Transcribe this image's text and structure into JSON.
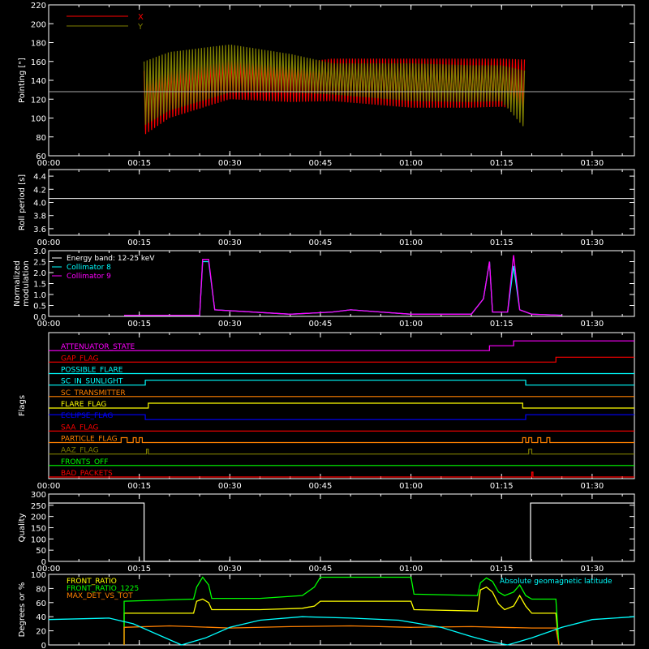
{
  "time_ticks": [
    "00:00",
    "00:15",
    "00:30",
    "00:45",
    "01:00",
    "01:15",
    "01:30"
  ],
  "chart_data": [
    {
      "type": "line",
      "ylabel": "Pointing [\"]",
      "ylim": [
        60,
        220
      ],
      "xlim_min": [
        0,
        97
      ],
      "yticks": [
        60,
        80,
        100,
        120,
        140,
        160,
        180,
        200,
        220
      ],
      "legend": [
        {
          "name": "X",
          "color": "#ff0000"
        },
        {
          "name": "Y",
          "color": "#808000"
        }
      ],
      "reference_line": 128,
      "series": [
        {
          "name": "X",
          "color": "#ff0000",
          "upper": [
            [
              15.8,
              150
            ],
            [
              20,
              155
            ],
            [
              30,
              162
            ],
            [
              40,
              158
            ],
            [
              47,
              163
            ],
            [
              60,
              163
            ],
            [
              70,
              163
            ],
            [
              75,
              163
            ],
            [
              79,
              162
            ]
          ],
          "lower": [
            [
              15.8,
              82
            ],
            [
              20,
              100
            ],
            [
              30,
              120
            ],
            [
              40,
              117
            ],
            [
              47,
              118
            ],
            [
              60,
              111
            ],
            [
              70,
              111
            ],
            [
              75,
              112
            ],
            [
              79,
              108
            ]
          ]
        },
        {
          "name": "Y",
          "color": "#808000",
          "upper": [
            [
              15.8,
              160
            ],
            [
              20,
              170
            ],
            [
              30,
              178
            ],
            [
              40,
              168
            ],
            [
              47,
              158
            ],
            [
              60,
              158
            ],
            [
              70,
              156
            ],
            [
              75,
              156
            ],
            [
              79,
              150
            ]
          ],
          "lower": [
            [
              15.8,
              92
            ],
            [
              20,
              108
            ],
            [
              30,
              127
            ],
            [
              40,
              127
            ],
            [
              47,
              125
            ],
            [
              60,
              118
            ],
            [
              70,
              117
            ],
            [
              75,
              118
            ],
            [
              79,
              88
            ]
          ]
        }
      ]
    },
    {
      "type": "line",
      "ylabel": "Roll period [s]",
      "ylim": [
        3.5,
        4.5
      ],
      "yticks": [
        3.6,
        3.8,
        4.0,
        4.2,
        4.4
      ],
      "series": [
        {
          "name": "",
          "color": "#ffffff",
          "constant": 4.06,
          "span": [
            0,
            97
          ]
        }
      ]
    },
    {
      "type": "line",
      "ylabel_lines": [
        "Normalized",
        "modulation"
      ],
      "ylim": [
        0,
        3.0
      ],
      "yticks": [
        0.0,
        0.5,
        1.0,
        1.5,
        2.0,
        2.5,
        3.0
      ],
      "legend": [
        {
          "name": "Energy band: 12-25 keV",
          "color": "#ffffff"
        },
        {
          "name": "Collimator 8",
          "color": "#00ffff"
        },
        {
          "name": "Collimator 9",
          "color": "#ff00ff"
        }
      ],
      "series": [
        {
          "name": "Collimator 8",
          "color": "#00ffff",
          "points": [
            [
              12.5,
              0.05
            ],
            [
              25,
              0.05
            ],
            [
              25.5,
              2.5
            ],
            [
              26.5,
              2.5
            ],
            [
              27.5,
              0.3
            ],
            [
              40,
              0.1
            ],
            [
              47,
              0.2
            ],
            [
              50,
              0.3
            ],
            [
              55,
              0.2
            ],
            [
              60,
              0.1
            ],
            [
              70,
              0.1
            ],
            [
              72,
              0.8
            ],
            [
              73,
              2.5
            ],
            [
              73.5,
              0.2
            ],
            [
              76,
              0.2
            ],
            [
              77,
              2.3
            ],
            [
              78,
              0.3
            ],
            [
              80,
              0.1
            ],
            [
              85,
              0.05
            ]
          ]
        },
        {
          "name": "Collimator 9",
          "color": "#ff00ff",
          "points": [
            [
              12.5,
              0.05
            ],
            [
              25,
              0.05
            ],
            [
              25.5,
              2.6
            ],
            [
              26.5,
              2.6
            ],
            [
              27.5,
              0.3
            ],
            [
              40,
              0.1
            ],
            [
              47,
              0.2
            ],
            [
              50,
              0.3
            ],
            [
              55,
              0.2
            ],
            [
              60,
              0.1
            ],
            [
              70,
              0.1
            ],
            [
              72,
              0.8
            ],
            [
              73,
              2.5
            ],
            [
              73.5,
              0.2
            ],
            [
              76,
              0.2
            ],
            [
              77,
              2.8
            ],
            [
              78,
              0.3
            ],
            [
              80,
              0.1
            ],
            [
              85,
              0.05
            ]
          ]
        }
      ]
    },
    {
      "type": "line",
      "ylabel": "Flags",
      "flags": [
        {
          "name": "ATTENUATOR_STATE",
          "color": "#ff00ff",
          "steps": [
            [
              0,
              0
            ],
            [
              73,
              1
            ],
            [
              77,
              2
            ],
            [
              97,
              2
            ]
          ]
        },
        {
          "name": "GAP_FLAG",
          "color": "#ff0000",
          "steps": [
            [
              0,
              0
            ],
            [
              84,
              1
            ],
            [
              97,
              1
            ]
          ]
        },
        {
          "name": "POSSIBLE_FLARE",
          "color": "#00ffff",
          "steps": [
            [
              0,
              0
            ],
            [
              97,
              0
            ]
          ]
        },
        {
          "name": "SC_IN_SUNLIGHT",
          "color": "#00ffff",
          "steps": [
            [
              0,
              0
            ],
            [
              16,
              1
            ],
            [
              79,
              0
            ],
            [
              97,
              0
            ]
          ]
        },
        {
          "name": "SC_TRANSMITTER",
          "color": "#ff8000",
          "steps": [
            [
              0,
              0
            ],
            [
              97,
              0
            ]
          ]
        },
        {
          "name": "FLARE_FLAG",
          "color": "#ffff00",
          "steps": [
            [
              0,
              0
            ],
            [
              16.5,
              1
            ],
            [
              78.5,
              0
            ],
            [
              97,
              0
            ]
          ]
        },
        {
          "name": "ECLIPSE_FLAG",
          "color": "#0000ff",
          "steps": [
            [
              0,
              1
            ],
            [
              16,
              0
            ],
            [
              79,
              1
            ],
            [
              97,
              1
            ]
          ]
        },
        {
          "name": "SAA_FLAG",
          "color": "#ff0000",
          "steps": [
            [
              0,
              0
            ],
            [
              97,
              0
            ]
          ]
        },
        {
          "name": "PARTICLE_FLAG",
          "color": "#ff8000",
          "steps": [
            [
              0,
              0
            ],
            [
              12,
              1
            ],
            [
              13,
              0
            ],
            [
              14,
              1
            ],
            [
              14.5,
              0
            ],
            [
              15,
              1
            ],
            [
              15.5,
              0
            ],
            [
              78.5,
              1
            ],
            [
              79,
              0
            ],
            [
              79.5,
              1
            ],
            [
              80,
              0
            ],
            [
              81,
              1
            ],
            [
              81.5,
              0
            ],
            [
              82.5,
              1
            ],
            [
              83,
              0
            ],
            [
              97,
              0
            ]
          ]
        },
        {
          "name": "AAZ_FLAG",
          "color": "#808000",
          "steps": [
            [
              0,
              0
            ],
            [
              16.2,
              1
            ],
            [
              16.5,
              0
            ],
            [
              79.5,
              1
            ],
            [
              80,
              0
            ],
            [
              97,
              0
            ]
          ]
        },
        {
          "name": "FRONTS_OFF",
          "color": "#00ff00",
          "steps": [
            [
              0,
              0
            ],
            [
              97,
              0
            ]
          ]
        },
        {
          "name": "BAD_PACKETS",
          "color": "#ff0000",
          "steps": [
            [
              0,
              0
            ],
            [
              80,
              1
            ],
            [
              80.2,
              0
            ],
            [
              97,
              0
            ]
          ]
        }
      ]
    },
    {
      "type": "line",
      "ylabel": "Quality",
      "ylim": [
        0,
        300
      ],
      "yticks": [
        0,
        50,
        100,
        150,
        200,
        250,
        300
      ],
      "series": [
        {
          "name": "",
          "color": "#ffffff",
          "steps": [
            [
              0,
              260
            ],
            [
              15.8,
              260
            ],
            [
              15.8,
              0
            ],
            [
              79.8,
              0
            ],
            [
              79.8,
              260
            ],
            [
              97,
              260
            ]
          ]
        }
      ]
    },
    {
      "type": "line",
      "ylabel": "Degrees or %",
      "ylim": [
        0,
        100
      ],
      "yticks": [
        0,
        20,
        40,
        60,
        80,
        100
      ],
      "legend": [
        {
          "name": "FRONT_RATIO",
          "color": "#ffff00"
        },
        {
          "name": "FRONT_RATIO_1225",
          "color": "#00ff00"
        },
        {
          "name": "MAX_DET_VS_TOT",
          "color": "#ff8000"
        },
        {
          "name": "Absolute geomagnetic latitude",
          "color": "#00ffff"
        }
      ],
      "series": [
        {
          "name": "FRONT_RATIO",
          "color": "#ffff00",
          "points": [
            [
              12.5,
              0
            ],
            [
              12.5,
              45
            ],
            [
              24,
              45
            ],
            [
              24.5,
              62
            ],
            [
              25.5,
              65
            ],
            [
              26.5,
              60
            ],
            [
              27,
              50
            ],
            [
              35,
              50
            ],
            [
              42,
              52
            ],
            [
              44,
              55
            ],
            [
              45,
              62
            ],
            [
              60,
              62
            ],
            [
              60.5,
              50
            ],
            [
              71,
              48
            ],
            [
              71.5,
              78
            ],
            [
              72.5,
              82
            ],
            [
              73.5,
              75
            ],
            [
              74.5,
              58
            ],
            [
              75.5,
              50
            ],
            [
              77,
              55
            ],
            [
              78,
              70
            ],
            [
              79,
              55
            ],
            [
              80,
              45
            ],
            [
              84,
              45
            ],
            [
              84.5,
              0
            ]
          ]
        },
        {
          "name": "FRONT_RATIO_1225",
          "color": "#00ff00",
          "points": [
            [
              12.5,
              0
            ],
            [
              12.5,
              62
            ],
            [
              24,
              65
            ],
            [
              24.5,
              82
            ],
            [
              25.5,
              96
            ],
            [
              26.5,
              85
            ],
            [
              27,
              66
            ],
            [
              35,
              66
            ],
            [
              42,
              70
            ],
            [
              44,
              82
            ],
            [
              45,
              96
            ],
            [
              60,
              96
            ],
            [
              60.5,
              72
            ],
            [
              71,
              70
            ],
            [
              71.5,
              88
            ],
            [
              72.5,
              95
            ],
            [
              73.5,
              90
            ],
            [
              74.5,
              75
            ],
            [
              75.5,
              70
            ],
            [
              77,
              75
            ],
            [
              78,
              85
            ],
            [
              79,
              70
            ],
            [
              80,
              65
            ],
            [
              84,
              65
            ],
            [
              84.5,
              0
            ]
          ]
        },
        {
          "name": "MAX_DET_VS_TOT",
          "color": "#ff8000",
          "points": [
            [
              12.5,
              0
            ],
            [
              12.5,
              25
            ],
            [
              20,
              27
            ],
            [
              30,
              24
            ],
            [
              40,
              26
            ],
            [
              50,
              27
            ],
            [
              60,
              25
            ],
            [
              70,
              26
            ],
            [
              75,
              25
            ],
            [
              80,
              24
            ],
            [
              84,
              24
            ],
            [
              84.5,
              0
            ]
          ]
        },
        {
          "name": "Absolute geomagnetic latitude",
          "color": "#00ffff",
          "points": [
            [
              0,
              36
            ],
            [
              10,
              38
            ],
            [
              14,
              30
            ],
            [
              18,
              15
            ],
            [
              22,
              0
            ],
            [
              26,
              10
            ],
            [
              30,
              25
            ],
            [
              35,
              35
            ],
            [
              42,
              40
            ],
            [
              50,
              38
            ],
            [
              58,
              35
            ],
            [
              65,
              25
            ],
            [
              70,
              12
            ],
            [
              73,
              5
            ],
            [
              76,
              0
            ],
            [
              80,
              10
            ],
            [
              85,
              25
            ],
            [
              90,
              36
            ],
            [
              97,
              40
            ]
          ]
        }
      ]
    }
  ]
}
